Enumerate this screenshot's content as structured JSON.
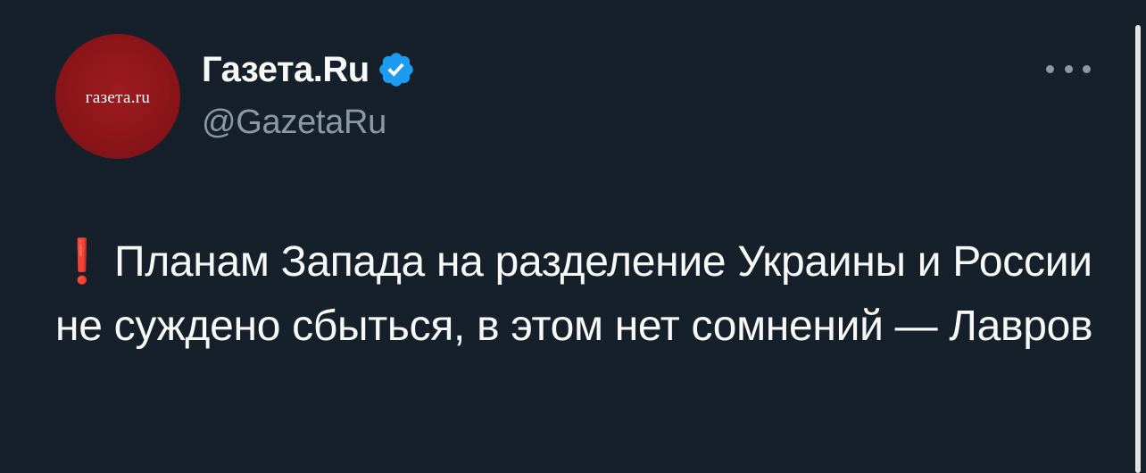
{
  "author": {
    "avatar_text": "газета.ru",
    "display_name": "Газета.Ru",
    "handle": "@GazetaRu"
  },
  "icons": {
    "verified": "verified-badge-icon",
    "more": "more-options-icon",
    "alert": "exclamation-icon"
  },
  "tweet": {
    "emoji": "❗",
    "text": "Планам Запада на разделение Украины и России не суждено сбыться, в этом нет сомнений — Лавров"
  },
  "colors": {
    "background": "#15202b",
    "text": "#f7f9f9",
    "secondary_text": "#8b98a5",
    "verified": "#1d9bf0",
    "avatar": "#8a1519",
    "alert": "#e8323a"
  }
}
